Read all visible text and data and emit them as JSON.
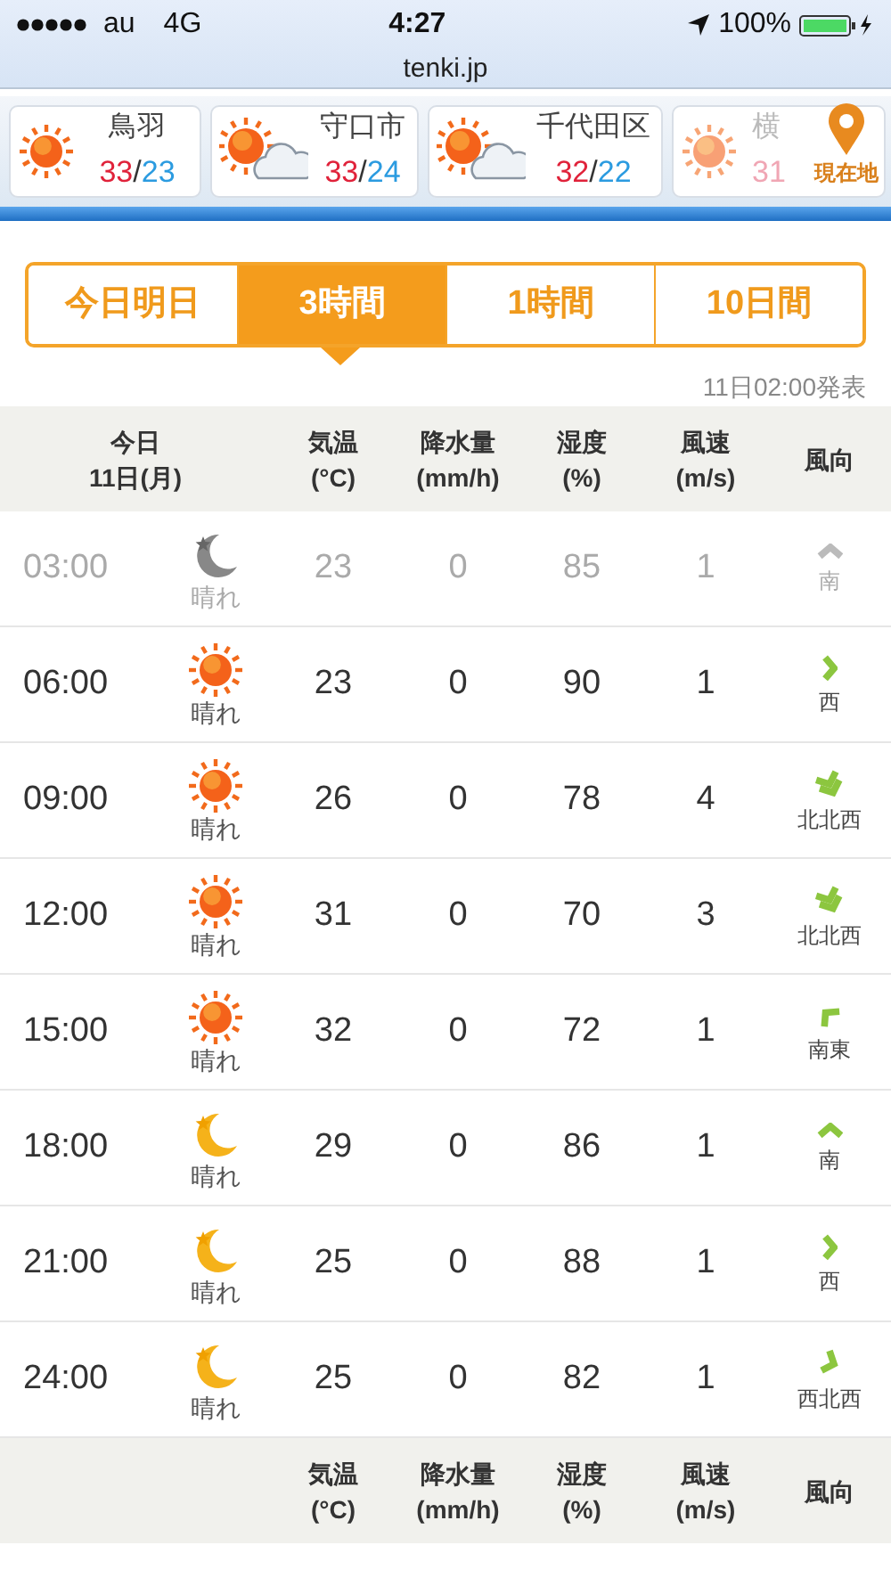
{
  "status_bar": {
    "carrier": "au",
    "network": "4G",
    "time": "4:27",
    "battery": "100%"
  },
  "address_bar": {
    "url": "tenki.jp"
  },
  "locations": [
    {
      "name": "鳥羽",
      "kind": "sun",
      "high": "33",
      "separator": "/",
      "low": "23",
      "faded": false
    },
    {
      "name": "守口市",
      "kind": "sun-cloud",
      "high": "33",
      "separator": "/",
      "low": "24",
      "faded": false
    },
    {
      "name": "千代田区",
      "kind": "sun-cloud",
      "high": "32",
      "separator": "/",
      "low": "22",
      "faded": false
    },
    {
      "name": "横",
      "kind": "sun",
      "high": "31",
      "faded": true
    }
  ],
  "current_location": {
    "label": "現在地"
  },
  "tabs": [
    {
      "label": "今日明日",
      "selected": false
    },
    {
      "label": "3時間",
      "selected": true
    },
    {
      "label": "1時間",
      "selected": false
    },
    {
      "label": "10日間",
      "selected": false
    }
  ],
  "published": "11日02:00発表",
  "table": {
    "header": {
      "day": "今日",
      "date": "11日(月)",
      "columns": [
        {
          "label": "気温",
          "unit": "(°C)"
        },
        {
          "label": "降水量",
          "unit": "(mm/h)"
        },
        {
          "label": "湿度",
          "unit": "(%)"
        },
        {
          "label": "風速",
          "unit": "(m/s)"
        },
        {
          "label": "風向"
        }
      ]
    },
    "rows": [
      {
        "time": "03:00",
        "kind": "moon",
        "weather": "晴れ",
        "temp": "23",
        "precip": "0",
        "humidity": "85",
        "wind_speed": "1",
        "wind_arrow": {
          "kind": "n",
          "double": false
        },
        "wind_dir": "南",
        "past": true
      },
      {
        "time": "06:00",
        "kind": "sun",
        "weather": "晴れ",
        "temp": "23",
        "precip": "0",
        "humidity": "90",
        "wind_speed": "1",
        "wind_arrow": {
          "kind": "e",
          "double": false
        },
        "wind_dir": "西",
        "past": false
      },
      {
        "time": "09:00",
        "kind": "sun",
        "weather": "晴れ",
        "temp": "26",
        "precip": "0",
        "humidity": "78",
        "wind_speed": "4",
        "wind_arrow": {
          "kind": "sse",
          "double": true
        },
        "wind_dir": "北北西",
        "past": false
      },
      {
        "time": "12:00",
        "kind": "sun",
        "weather": "晴れ",
        "temp": "31",
        "precip": "0",
        "humidity": "70",
        "wind_speed": "3",
        "wind_arrow": {
          "kind": "sse",
          "double": true
        },
        "wind_dir": "北北西",
        "past": false
      },
      {
        "time": "15:00",
        "kind": "sun",
        "weather": "晴れ",
        "temp": "32",
        "precip": "0",
        "humidity": "72",
        "wind_speed": "1",
        "wind_arrow": {
          "kind": "nw",
          "double": false
        },
        "wind_dir": "南東",
        "past": false
      },
      {
        "time": "18:00",
        "kind": "moon",
        "weather": "晴れ",
        "temp": "29",
        "precip": "0",
        "humidity": "86",
        "wind_speed": "1",
        "wind_arrow": {
          "kind": "n",
          "double": false
        },
        "wind_dir": "南",
        "past": false
      },
      {
        "time": "21:00",
        "kind": "moon",
        "weather": "晴れ",
        "temp": "25",
        "precip": "0",
        "humidity": "88",
        "wind_speed": "1",
        "wind_arrow": {
          "kind": "e",
          "double": false
        },
        "wind_dir": "西",
        "past": false
      },
      {
        "time": "24:00",
        "kind": "moon",
        "weather": "晴れ",
        "temp": "25",
        "precip": "0",
        "humidity": "82",
        "wind_speed": "1",
        "wind_arrow": {
          "kind": "ese",
          "double": false
        },
        "wind_dir": "西北西",
        "past": false
      }
    ],
    "footer": {
      "columns": [
        {
          "label": "気温",
          "unit": "(°C)"
        },
        {
          "label": "降水量",
          "unit": "(mm/h)"
        },
        {
          "label": "湿度",
          "unit": "(%)"
        },
        {
          "label": "風速",
          "unit": "(m/s)"
        },
        {
          "label": "風向"
        }
      ]
    }
  }
}
